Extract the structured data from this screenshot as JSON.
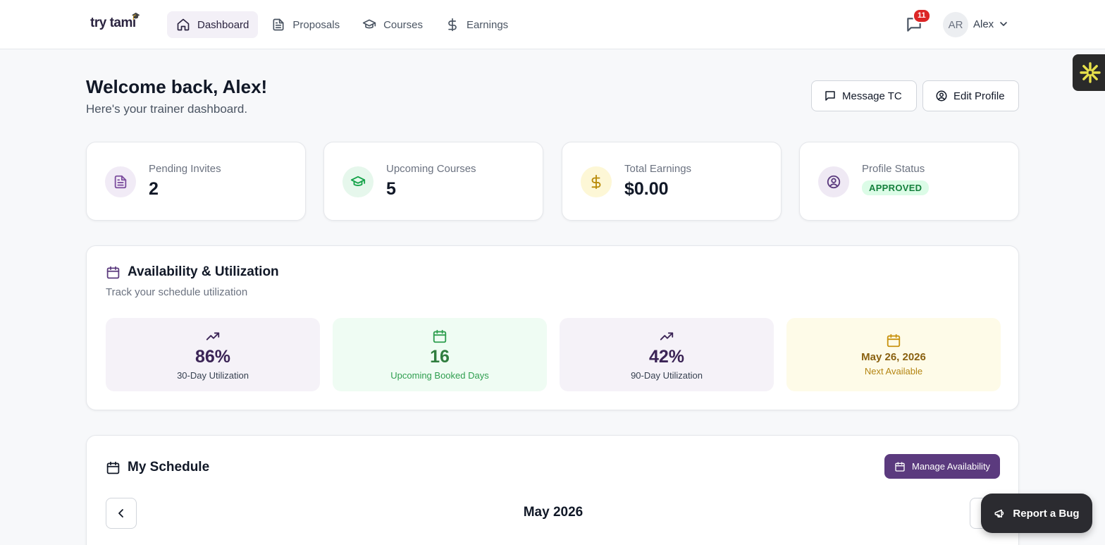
{
  "brand": {
    "logo_text": "try tami"
  },
  "nav": {
    "items": [
      {
        "label": "Dashboard",
        "icon": "home-icon",
        "active": true
      },
      {
        "label": "Proposals",
        "icon": "document-icon"
      },
      {
        "label": "Courses",
        "icon": "graduation-cap-icon"
      },
      {
        "label": "Earnings",
        "icon": "dollar-icon"
      }
    ]
  },
  "header": {
    "message_badge": "11",
    "avatar_initials": "AR",
    "user_name": "Alex"
  },
  "welcome": {
    "title": "Welcome back, Alex!",
    "subtitle": "Here's your trainer dashboard.",
    "message_button": "Message TC",
    "edit_profile_button": "Edit Profile"
  },
  "stats": [
    {
      "label": "Pending Invites",
      "value": "2",
      "icon": "document-icon",
      "color": "#7c4d9e",
      "bg": "#f1ebf6"
    },
    {
      "label": "Upcoming Courses",
      "value": "5",
      "icon": "graduation-cap-icon",
      "color": "#16a34a",
      "bg": "#e6f7ec"
    },
    {
      "label": "Total Earnings",
      "value": "$0.00",
      "icon": "dollar-icon",
      "color": "#b88a07",
      "bg": "#fdf7d6"
    },
    {
      "label": "Profile Status",
      "value": "APPROVED",
      "icon": "user-circle-icon",
      "color": "#5b3a7e",
      "bg": "#efe9f4"
    }
  ],
  "availability": {
    "title": "Availability & Utilization",
    "subtitle": "Track your schedule utilization",
    "cards": [
      {
        "value": "86%",
        "label": "30-Day Utilization",
        "icon": "trending-up-icon"
      },
      {
        "value": "16",
        "label": "Upcoming Booked Days",
        "icon": "calendar-icon"
      },
      {
        "value": "42%",
        "label": "90-Day Utilization",
        "icon": "trending-up-icon"
      },
      {
        "value": "May 26, 2026",
        "label": "Next Available",
        "icon": "calendar-icon"
      }
    ]
  },
  "schedule": {
    "title": "My Schedule",
    "manage_button": "Manage Availability",
    "month": "May 2026"
  },
  "report_bug": {
    "label": "Report a Bug"
  },
  "colors": {
    "brand_purple": "#5b3a7e",
    "success_green": "#15803d",
    "warning_gold": "#a16207"
  }
}
